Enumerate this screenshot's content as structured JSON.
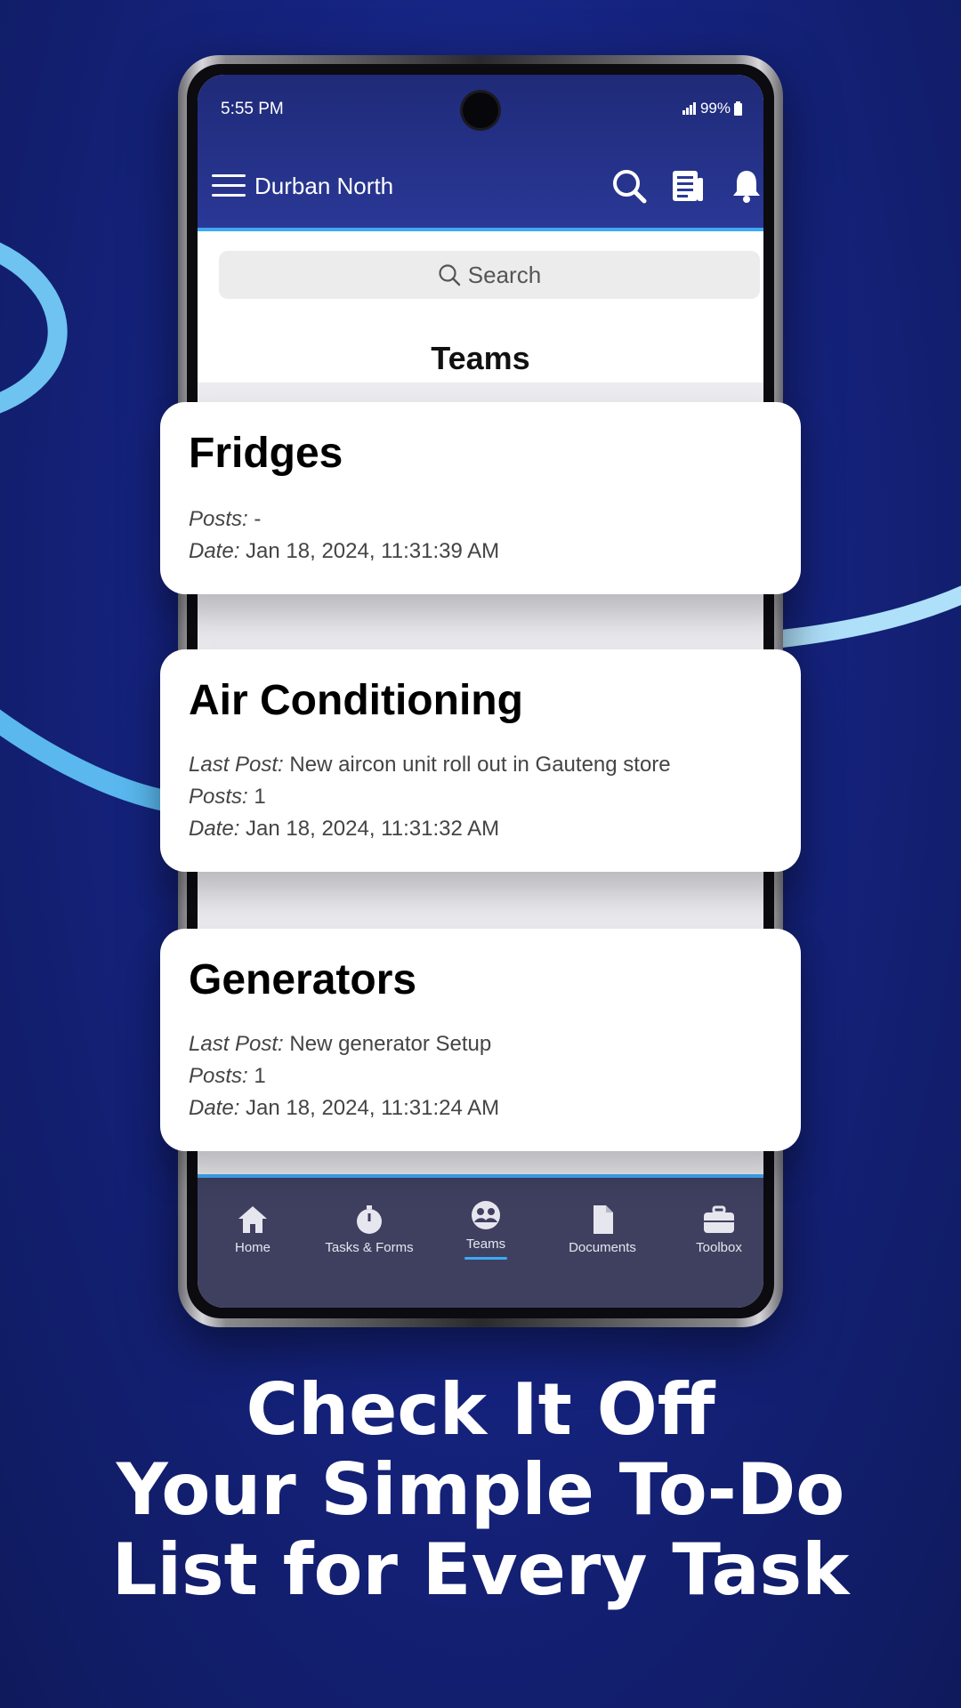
{
  "status": {
    "time": "5:55 PM",
    "battery": "99%"
  },
  "header": {
    "location": "Durban North"
  },
  "search": {
    "placeholder": "Search"
  },
  "page": {
    "title": "Teams"
  },
  "cards": [
    {
      "title": "Fridges",
      "posts_label": "Posts:",
      "posts": "-",
      "date_label": "Date:",
      "date": "Jan 18, 2024, 11:31:39 AM"
    },
    {
      "title": "Air Conditioning",
      "last_post_label": "Last Post:",
      "last_post": "New aircon unit roll out in Gauteng store",
      "posts_label": "Posts:",
      "posts": "1",
      "date_label": "Date:",
      "date": "Jan 18, 2024, 11:31:32 AM"
    },
    {
      "title": "Generators",
      "last_post_label": "Last Post:",
      "last_post": "New generator Setup",
      "posts_label": "Posts:",
      "posts": "1",
      "date_label": "Date:",
      "date": "Jan 18, 2024, 11:31:24 AM"
    }
  ],
  "nav": [
    {
      "label": "Home",
      "icon": "home-icon"
    },
    {
      "label": "Tasks & Forms",
      "icon": "timer-icon"
    },
    {
      "label": "Teams",
      "icon": "teams-icon",
      "active": true
    },
    {
      "label": "Documents",
      "icon": "document-icon"
    },
    {
      "label": "Toolbox",
      "icon": "toolbox-icon"
    }
  ],
  "headline": {
    "line1": "Check It Off",
    "line2": "Your Simple To-Do",
    "line3": "List for Every Task"
  },
  "colors": {
    "accent": "#3fa9f5",
    "background": "#15237f",
    "header": "#2a3896",
    "nav": "#3f4060"
  }
}
